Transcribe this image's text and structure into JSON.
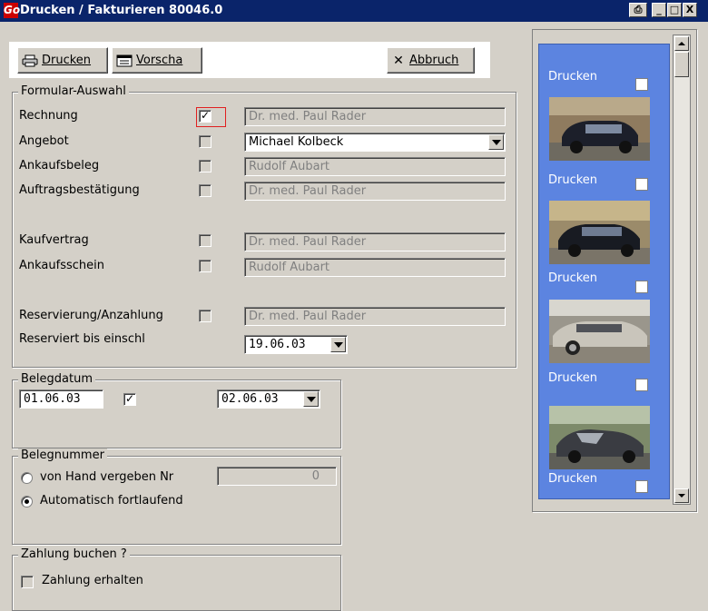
{
  "window": {
    "title": "Drucken / Fakturieren 80046.0",
    "logo_text": "Go"
  },
  "toolbar": {
    "print_label": "Drucken",
    "preview_label": "Vorscha",
    "cancel_label": "Abbruch"
  },
  "formular": {
    "legend": "Formular-Auswahl",
    "rows": [
      {
        "label": "Rechnung",
        "checked": true,
        "value": "Dr. med. Paul Rader"
      },
      {
        "label": "Angebot",
        "checked": false,
        "value": "Michael Kolbeck"
      },
      {
        "label": "Ankaufsbeleg",
        "checked": false,
        "value": "Rudolf Aubart"
      },
      {
        "label": "Auftragsbestätigung",
        "checked": false,
        "value": "Dr. med. Paul Rader"
      },
      {
        "label": "Kaufvertrag",
        "checked": false,
        "value": "Dr. med. Paul Rader"
      },
      {
        "label": "Ankaufsschein",
        "checked": false,
        "value": "Rudolf Aubart"
      },
      {
        "label": "Reservierung/Anzahlung",
        "checked": false,
        "value": "Dr. med. Paul Rader"
      }
    ],
    "reserviert_label": "Reserviert bis einschl",
    "reserviert_date": "19.06.03"
  },
  "belegdatum": {
    "legend": "Belegdatum",
    "date_from": "01.06.03",
    "checked": true,
    "date_to": "02.06.03"
  },
  "belegnummer": {
    "legend": "Belegnummer",
    "manual_label": "von Hand vergeben Nr",
    "manual_value": "0",
    "auto_label": "Automatisch fortlaufend",
    "selected": "auto"
  },
  "zahlung": {
    "legend": "Zahlung buchen ?",
    "received_label": "Zahlung erhalten",
    "checked": false
  },
  "images_panel": {
    "tile_label": "Drucken",
    "labels": [
      "Drucken",
      "Drucken",
      "Drucken",
      "Drucken",
      "Drucken"
    ]
  },
  "colors": {
    "titlebar": "#0a246a",
    "panel": "#5c84e0",
    "face": "#d4d0c8"
  }
}
